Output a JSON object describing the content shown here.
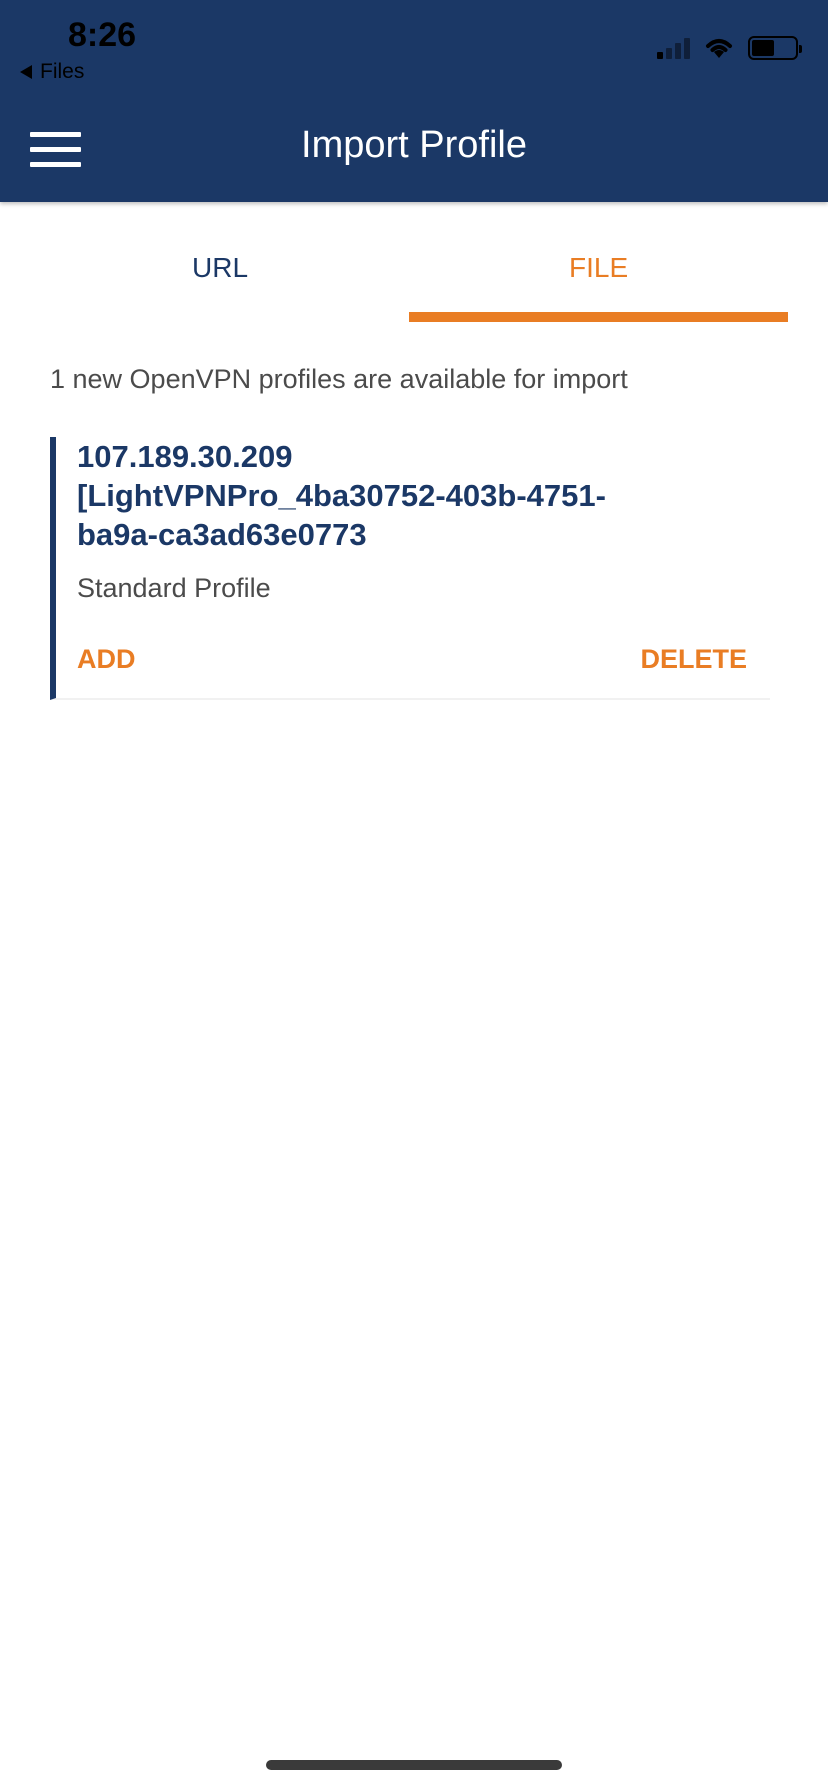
{
  "status_bar": {
    "time": "8:26",
    "back_app": "Files",
    "icons": [
      "cellular-signal-icon",
      "wifi-icon",
      "battery-icon"
    ]
  },
  "header": {
    "title": "Import Profile",
    "menu_icon": "hamburger-menu-icon"
  },
  "tabs": [
    {
      "label": "URL",
      "active": false
    },
    {
      "label": "FILE",
      "active": true
    }
  ],
  "main": {
    "available_text": "1 new OpenVPN profiles are available for import",
    "profiles": [
      {
        "name_lines": [
          "107.189.30.209",
          "[LightVPNPro_4ba30752-403b-4751-",
          "ba9a-ca3ad63e0773"
        ],
        "type": "Standard Profile",
        "add_label": "ADD",
        "delete_label": "DELETE"
      }
    ]
  },
  "colors": {
    "header_bg": "#1b3866",
    "accent": "#e97d24",
    "primary_text": "#1b3866",
    "secondary_text": "#4b4b4b"
  }
}
